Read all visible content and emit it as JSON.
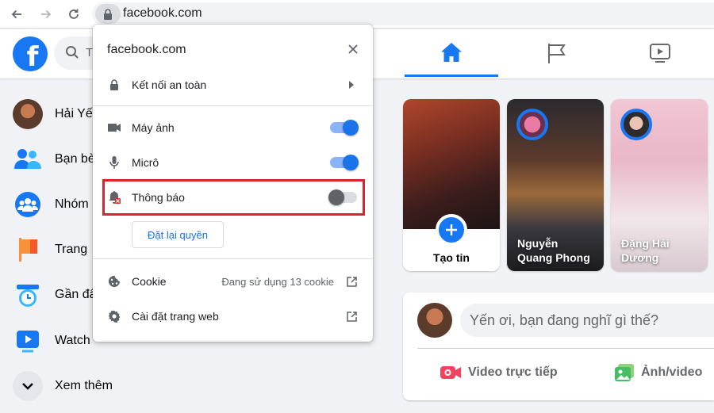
{
  "browser": {
    "url": "facebook.com"
  },
  "fb": {
    "search_placeholder": "T",
    "sidebar": [
      {
        "label": "Hải Yế",
        "icon": "profile-avatar"
      },
      {
        "label": "Bạn bè",
        "icon": "friends-icon"
      },
      {
        "label": "Nhóm",
        "icon": "groups-icon"
      },
      {
        "label": "Trang",
        "icon": "pages-flag-icon"
      },
      {
        "label": "Gần đâ",
        "icon": "memories-clock-icon"
      },
      {
        "label": "Watch",
        "icon": "watch-icon"
      },
      {
        "label": "Xem thêm",
        "icon": "chevron-down-icon"
      }
    ],
    "stories": {
      "create_label": "Tạo tin",
      "story1_name_line1": "Nguyễn",
      "story1_name_line2": "Quang Phong",
      "story2_name_line1": "Đặng Hải",
      "story2_name_line2": "Dương"
    },
    "composer": {
      "placeholder": "Yến ơi, bạn đang nghĩ gì thế?",
      "live_label": "Video trực tiếp",
      "photo_label": "Ảnh/video"
    }
  },
  "popup": {
    "title": "facebook.com",
    "connection_label": "Kết nối an toàn",
    "camera_label": "Máy ảnh",
    "camera_on": true,
    "mic_label": "Micrô",
    "mic_on": true,
    "notifications_label": "Thông báo",
    "notifications_on": false,
    "reset_label": "Đặt lại quyền",
    "cookie_label": "Cookie",
    "cookie_value": "Đang sử dụng 13 cookie",
    "site_settings_label": "Cài đặt trang web"
  },
  "colors": {
    "fb_blue": "#1877f2",
    "chrome_blue": "#1a73e8",
    "highlight_red": "#e0202f"
  }
}
